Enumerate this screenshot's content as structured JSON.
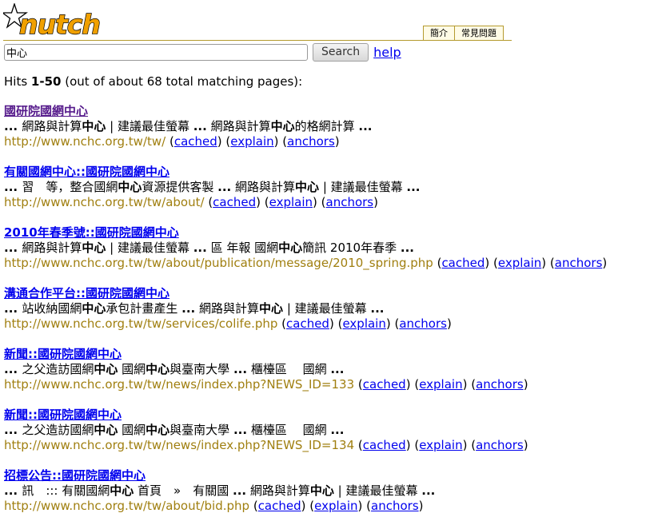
{
  "header": {
    "logo_text": "nutch",
    "tabs": [
      "簡介",
      "常見問題"
    ]
  },
  "search": {
    "query": "中心",
    "button_label": "Search",
    "help_label": "help"
  },
  "hits": {
    "prefix": "Hits ",
    "range": "1-50",
    "suffix": " (out of about 68 total matching pages):"
  },
  "result_actions": {
    "cached": "cached",
    "explain": "explain",
    "anchors": "anchors"
  },
  "results": [
    {
      "title": "國研院國網中心",
      "visited": true,
      "snippet": [
        {
          "t": "... ",
          "b": true
        },
        {
          "t": "網路與計算",
          "b": false
        },
        {
          "t": "中心",
          "b": true
        },
        {
          "t": " | 建議最佳螢幕 ",
          "b": false
        },
        {
          "t": "...",
          "b": true
        },
        {
          "t": " 網路與計算",
          "b": false
        },
        {
          "t": "中心",
          "b": true
        },
        {
          "t": "的格網計算 ",
          "b": false
        },
        {
          "t": "...",
          "b": true
        }
      ],
      "url": "http://www.nchc.org.tw/tw/"
    },
    {
      "title": "有關國網中心::國研院國網中心",
      "visited": false,
      "snippet": [
        {
          "t": "... ",
          "b": true
        },
        {
          "t": "習　等，整合國網",
          "b": false
        },
        {
          "t": "中心",
          "b": true
        },
        {
          "t": "資源提供客製 ",
          "b": false
        },
        {
          "t": "...",
          "b": true
        },
        {
          "t": " 網路與計算",
          "b": false
        },
        {
          "t": "中心",
          "b": true
        },
        {
          "t": " | 建議最佳螢幕 ",
          "b": false
        },
        {
          "t": "...",
          "b": true
        }
      ],
      "url": "http://www.nchc.org.tw/tw/about/"
    },
    {
      "title": "2010年春季號::國研院國網中心",
      "visited": false,
      "snippet": [
        {
          "t": "... ",
          "b": true
        },
        {
          "t": "網路與計算",
          "b": false
        },
        {
          "t": "中心",
          "b": true
        },
        {
          "t": " | 建議最佳螢幕 ",
          "b": false
        },
        {
          "t": "...",
          "b": true
        },
        {
          "t": " 區 年報 國網",
          "b": false
        },
        {
          "t": "中心",
          "b": true
        },
        {
          "t": "簡訊 2010年春季 ",
          "b": false
        },
        {
          "t": "...",
          "b": true
        }
      ],
      "url": "http://www.nchc.org.tw/tw/about/publication/message/2010_spring.php"
    },
    {
      "title": "溝通合作平台::國研院國網中心",
      "visited": false,
      "snippet": [
        {
          "t": "... ",
          "b": true
        },
        {
          "t": "站收納國網",
          "b": false
        },
        {
          "t": "中心",
          "b": true
        },
        {
          "t": "承包計畫產生 ",
          "b": false
        },
        {
          "t": "...",
          "b": true
        },
        {
          "t": " 網路與計算",
          "b": false
        },
        {
          "t": "中心",
          "b": true
        },
        {
          "t": " | 建議最佳螢幕 ",
          "b": false
        },
        {
          "t": "...",
          "b": true
        }
      ],
      "url": "http://www.nchc.org.tw/tw/services/colife.php"
    },
    {
      "title": "新聞::國研院國網中心",
      "visited": false,
      "snippet": [
        {
          "t": "... ",
          "b": true
        },
        {
          "t": "之父造訪國網",
          "b": false
        },
        {
          "t": "中心",
          "b": true
        },
        {
          "t": " 國網",
          "b": false
        },
        {
          "t": "中心",
          "b": true
        },
        {
          "t": "與臺南大學 ",
          "b": false
        },
        {
          "t": "...",
          "b": true
        },
        {
          "t": " 櫃檯區　  國網 ",
          "b": false
        },
        {
          "t": "...",
          "b": true
        }
      ],
      "url": "http://www.nchc.org.tw/tw/news/index.php?NEWS_ID=133"
    },
    {
      "title": "新聞::國研院國網中心",
      "visited": false,
      "snippet": [
        {
          "t": "... ",
          "b": true
        },
        {
          "t": "之父造訪國網",
          "b": false
        },
        {
          "t": "中心",
          "b": true
        },
        {
          "t": " 國網",
          "b": false
        },
        {
          "t": "中心",
          "b": true
        },
        {
          "t": "與臺南大學 ",
          "b": false
        },
        {
          "t": "...",
          "b": true
        },
        {
          "t": " 櫃檯區　  國網 ",
          "b": false
        },
        {
          "t": "...",
          "b": true
        }
      ],
      "url": "http://www.nchc.org.tw/tw/news/index.php?NEWS_ID=134"
    },
    {
      "title": "招標公告::國研院國網中心",
      "visited": false,
      "snippet": [
        {
          "t": "... ",
          "b": true
        },
        {
          "t": "訊　::: 有關國網",
          "b": false
        },
        {
          "t": "中心",
          "b": true
        },
        {
          "t": " 首頁　»　有關國 ",
          "b": false
        },
        {
          "t": "...",
          "b": true
        },
        {
          "t": " 網路與計算",
          "b": false
        },
        {
          "t": "中心",
          "b": true
        },
        {
          "t": " | 建議最佳螢幕 ",
          "b": false
        },
        {
          "t": "...",
          "b": true
        }
      ],
      "url": "http://www.nchc.org.tw/tw/about/bid.php"
    }
  ]
}
